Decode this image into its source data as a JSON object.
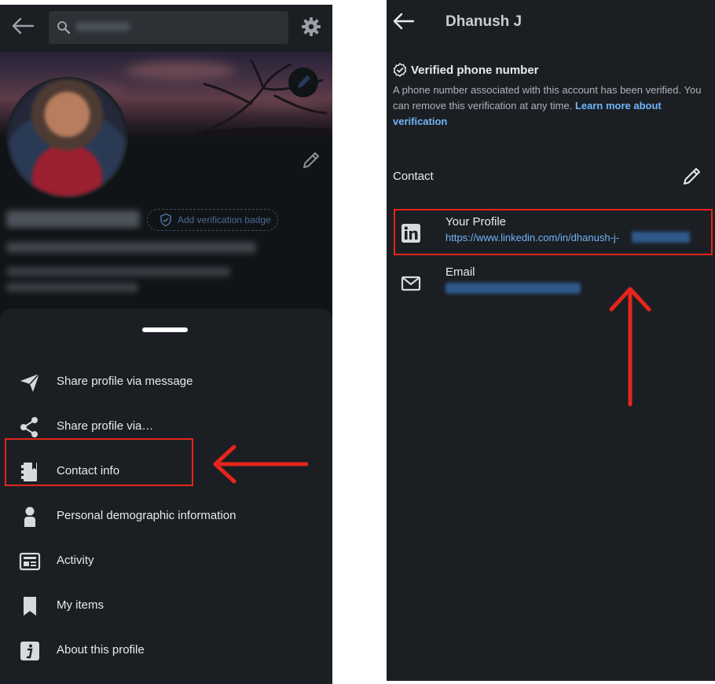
{
  "left_screen": {
    "search": {
      "placeholder": ""
    },
    "verify_badge": "Add verification badge",
    "menu": [
      {
        "label": "Share profile via message",
        "icon": "send-icon"
      },
      {
        "label": "Share profile via…",
        "icon": "share-icon"
      },
      {
        "label": "Contact info",
        "icon": "contact-book-icon"
      },
      {
        "label": "Personal demographic information",
        "icon": "person-icon"
      },
      {
        "label": "Activity",
        "icon": "activity-icon"
      },
      {
        "label": "My items",
        "icon": "bookmark-icon"
      },
      {
        "label": "About this profile",
        "icon": "info-icon"
      }
    ]
  },
  "right_screen": {
    "title": "Dhanush J",
    "verified": {
      "title": "Verified phone number",
      "desc": "A phone number associated with this account has been verified. You can remove this verification at any time. ",
      "link": "Learn more about verification"
    },
    "contact_label": "Contact",
    "profile": {
      "title": "Your Profile",
      "url": "https://www.linkedin.com/in/dhanush-j-"
    },
    "email": {
      "title": "Email"
    }
  },
  "colors": {
    "background": "#1b1f23",
    "link": "#70b5f9",
    "annotation": "#e5251c"
  }
}
